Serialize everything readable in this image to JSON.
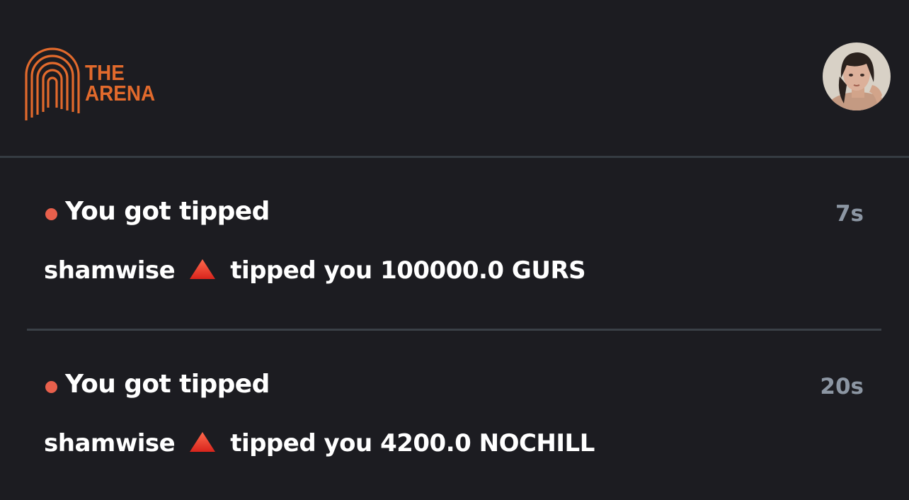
{
  "header": {
    "logo_line1": "THE",
    "logo_line2": "ARENA",
    "logo_color": "#e26a2c"
  },
  "notifications": [
    {
      "title": "You got tipped",
      "time": "7s",
      "user": "shamwise",
      "icon": "red-triangle-icon",
      "message": "tipped you 100000.0 GURS"
    },
    {
      "title": "You got tipped",
      "time": "20s",
      "user": "shamwise",
      "icon": "red-triangle-icon",
      "message": "tipped you 4200.0 NOCHILL"
    }
  ],
  "colors": {
    "background": "#1c1c21",
    "unread_dot": "#e8604c",
    "timestamp": "#8c96a3",
    "divider": "#353b42"
  }
}
